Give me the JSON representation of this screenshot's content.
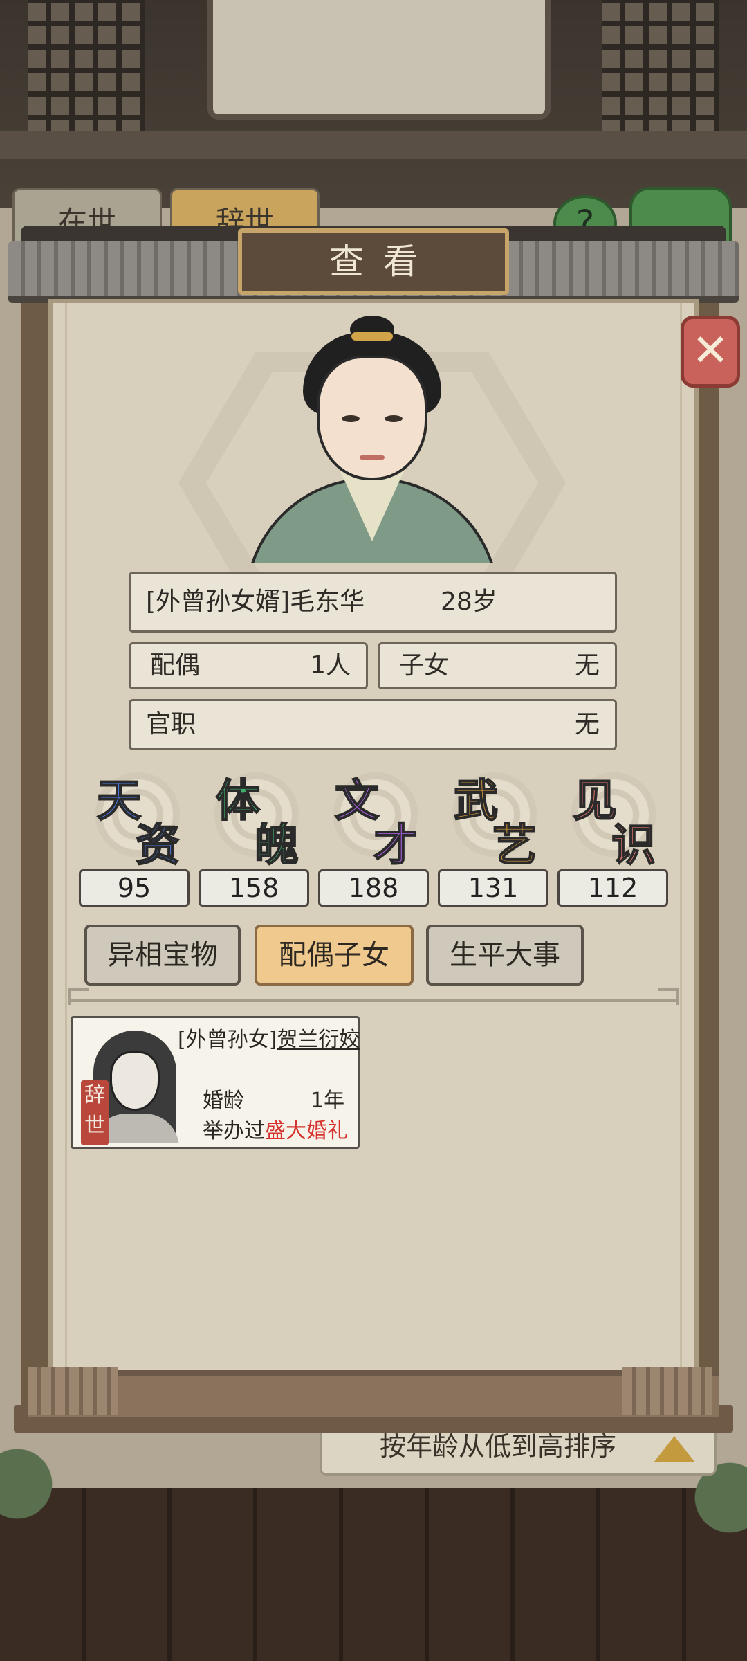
{
  "top_tabs": {
    "alive": "在世",
    "dead": "辞世"
  },
  "sort_bar": {
    "label": "按年龄从低到高排序"
  },
  "dialog": {
    "title": "查看",
    "close_symbol": "✕"
  },
  "person": {
    "name_line": "[外曾孙女婿]毛东华",
    "age": "28岁",
    "spouse_label": "配偶",
    "spouse_value": "1人",
    "children_label": "子女",
    "children_value": "无",
    "office_label": "官职",
    "office_value": "无"
  },
  "stats": [
    {
      "c1": "天",
      "c2": "资",
      "value": "95",
      "color": "#4a7be0"
    },
    {
      "c1": "体",
      "c2": "魄",
      "value": "158",
      "color": "#3fb06a"
    },
    {
      "c1": "文",
      "c2": "才",
      "value": "188",
      "color": "#a35bd6"
    },
    {
      "c1": "武",
      "c2": "艺",
      "value": "131",
      "color": "#e7a33c"
    },
    {
      "c1": "见",
      "c2": "识",
      "value": "112",
      "color": "#e0746b"
    }
  ],
  "tabs": [
    {
      "label": "异相宝物",
      "selected": false
    },
    {
      "label": "配偶子女",
      "selected": true
    },
    {
      "label": "生平大事",
      "selected": false
    }
  ],
  "spouse_card": {
    "relation": "[外曾孙女]",
    "name": "贺兰衍姣",
    "status_seal": "辞世",
    "marriage_label": "婚龄",
    "marriage_value": "1年",
    "held_prefix": "举办过",
    "held_value": "盛大婚礼"
  },
  "colors": {
    "accent_gold": "#efc98e",
    "close_red": "#c9625a",
    "highlight_red": "#d7312d"
  }
}
